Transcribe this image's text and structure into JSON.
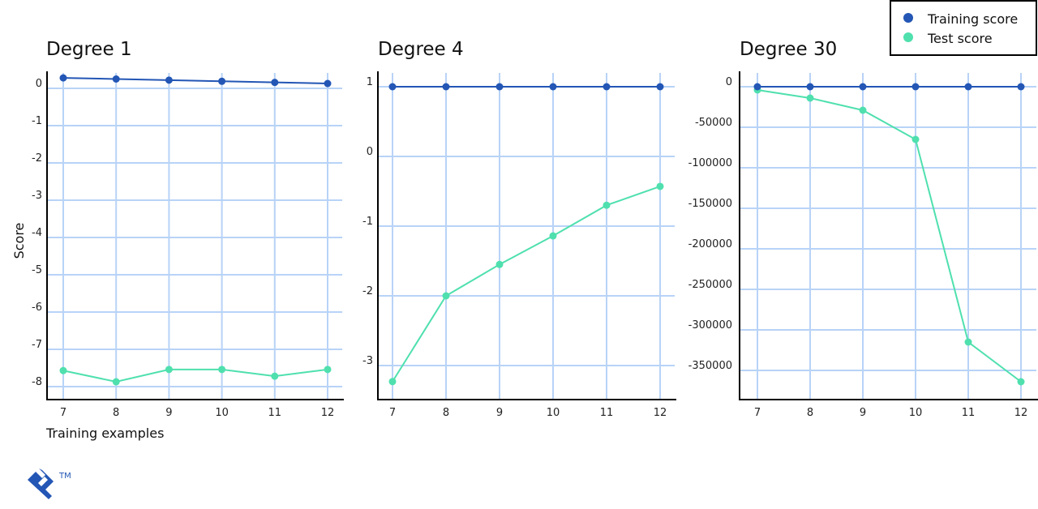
{
  "colors": {
    "training": "#2356b5",
    "test": "#4fe0ae",
    "grid": "#b8d3f7",
    "axis": "#000000",
    "logo": "#2356b5"
  },
  "legend": {
    "position": "top-right",
    "items": [
      {
        "label": "Training score",
        "series": "training"
      },
      {
        "label": "Test score",
        "series": "test"
      }
    ]
  },
  "logo": {
    "trademark": "TM"
  },
  "chart_data": [
    {
      "type": "line",
      "title": "Degree 1",
      "xlabel": "Training examples",
      "ylabel": "Score",
      "x": [
        7,
        8,
        9,
        10,
        11,
        12
      ],
      "x_ticks": [
        "7",
        "8",
        "9",
        "10",
        "11",
        "12"
      ],
      "y_ticks": [
        0,
        -1,
        -2,
        -3,
        -4,
        -5,
        -6,
        -7,
        -8
      ],
      "y_tick_labels": [
        "0",
        "-1",
        "-2",
        "-3",
        "-4",
        "-5",
        "-6",
        "-7",
        "-8"
      ],
      "ylim": [
        -8.35,
        0.45
      ],
      "grid": true,
      "series": [
        {
          "name": "Training score",
          "key": "training",
          "values": [
            0.28,
            0.25,
            0.22,
            0.19,
            0.16,
            0.13
          ]
        },
        {
          "name": "Test score",
          "key": "test",
          "values": [
            -7.57,
            -7.87,
            -7.54,
            -7.54,
            -7.72,
            -7.54
          ]
        }
      ]
    },
    {
      "type": "line",
      "title": "Degree 4",
      "xlabel": "",
      "ylabel": "",
      "x": [
        7,
        8,
        9,
        10,
        11,
        12
      ],
      "x_ticks": [
        "7",
        "8",
        "9",
        "10",
        "11",
        "12"
      ],
      "y_ticks": [
        1,
        0,
        -1,
        -2,
        -3
      ],
      "y_tick_labels": [
        "1",
        "0",
        "-1",
        "-2",
        "-3"
      ],
      "ylim": [
        -3.47,
        1.2
      ],
      "grid": true,
      "series": [
        {
          "name": "Training score",
          "key": "training",
          "values": [
            1.0,
            1.0,
            1.0,
            1.0,
            1.0,
            1.0
          ]
        },
        {
          "name": "Test score",
          "key": "test",
          "values": [
            -3.23,
            -2.0,
            -1.55,
            -1.14,
            -0.7,
            -0.43
          ]
        }
      ]
    },
    {
      "type": "line",
      "title": "Degree 30",
      "xlabel": "",
      "ylabel": "",
      "x": [
        7,
        8,
        9,
        10,
        11,
        12
      ],
      "x_ticks": [
        "7",
        "8",
        "9",
        "10",
        "11",
        "12"
      ],
      "y_ticks": [
        0,
        -50000,
        -100000,
        -150000,
        -200000,
        -250000,
        -300000,
        -350000
      ],
      "y_tick_labels": [
        "0",
        "-50000",
        "-100000",
        "-150000",
        "-200000",
        "-250000",
        "-300000",
        "-350000"
      ],
      "ylim": [
        -386000,
        18000
      ],
      "grid": true,
      "series": [
        {
          "name": "Training score",
          "key": "training",
          "values": [
            0,
            0,
            0,
            0,
            0,
            0
          ]
        },
        {
          "name": "Test score",
          "key": "test",
          "values": [
            -4000,
            -14000,
            -29000,
            -65000,
            -315000,
            -364000
          ]
        }
      ]
    }
  ]
}
